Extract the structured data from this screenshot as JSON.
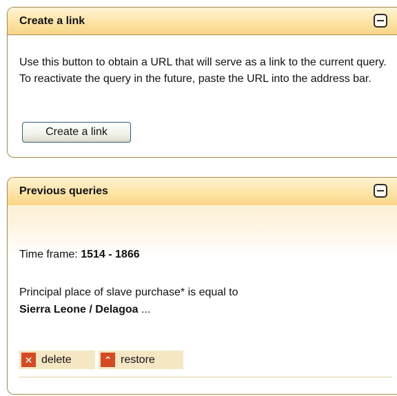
{
  "create_link_panel": {
    "title": "Create a link",
    "description": "Use this button to obtain a URL that will serve as a link to the current query. To reactivate the query in the future, paste the URL into the address bar.",
    "button_label": "Create a link"
  },
  "previous_queries_panel": {
    "title": "Previous queries",
    "time_frame_label": "Time frame: ",
    "time_frame_value": "1514 - 1866",
    "criterion_text": "Principal place of slave purchase* is equal to",
    "criterion_value": "Sierra Leone / Delagoa",
    "criterion_ellipsis": " ...",
    "delete_label": "delete",
    "restore_label": "restore",
    "delete_icon": "✕",
    "restore_icon": "⌃"
  },
  "colors": {
    "header_gold": "#fde4a6",
    "border_brown": "#a78a4a",
    "action_red": "#d44a23",
    "action_bg": "#f5e6c4"
  }
}
